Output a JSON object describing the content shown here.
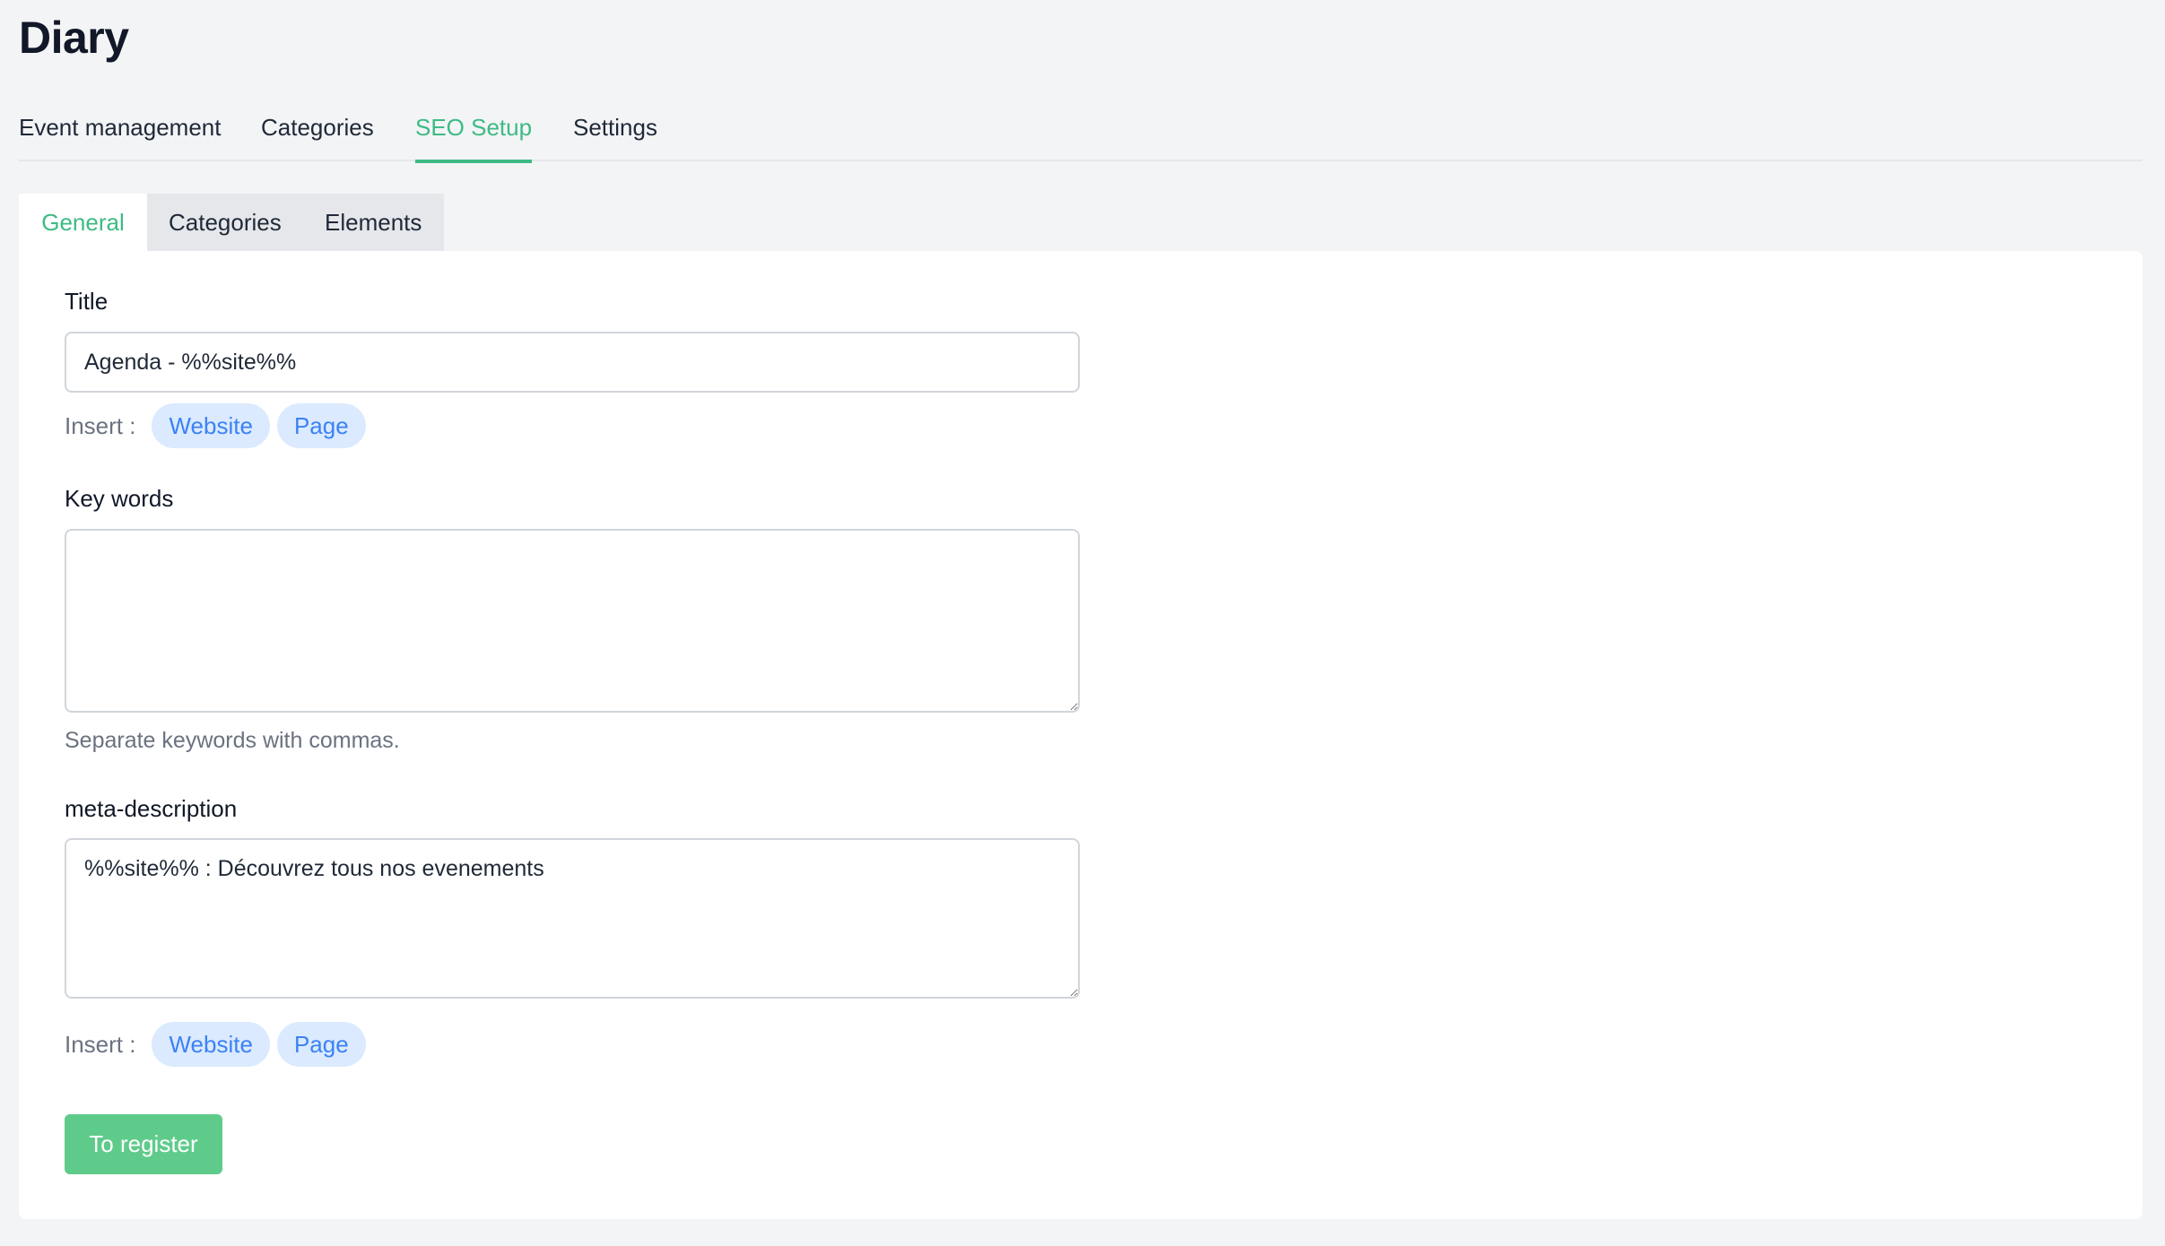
{
  "page": {
    "title": "Diary"
  },
  "main_tabs": [
    {
      "label": "Event management",
      "active": false
    },
    {
      "label": "Categories",
      "active": false
    },
    {
      "label": "SEO Setup",
      "active": true
    },
    {
      "label": "Settings",
      "active": false
    }
  ],
  "sub_tabs": [
    {
      "label": "General",
      "active": true
    },
    {
      "label": "Categories",
      "active": false
    },
    {
      "label": "Elements",
      "active": false
    }
  ],
  "form": {
    "title": {
      "label": "Title",
      "value": "Agenda - %%site%%"
    },
    "title_insert": {
      "label": "Insert :",
      "chips": [
        "Website",
        "Page"
      ]
    },
    "keywords": {
      "label": "Key words",
      "value": "",
      "help": "Separate keywords with commas."
    },
    "meta_description": {
      "label": "meta-description",
      "value": "%%site%% : Découvrez tous nos evenements"
    },
    "meta_insert": {
      "label": "Insert :",
      "chips": [
        "Website",
        "Page"
      ]
    },
    "submit_label": "To register"
  },
  "colors": {
    "accent": "#3dbb84",
    "button": "#5fcb8b",
    "chip_bg": "#dbeafe",
    "chip_text": "#3b82f6",
    "background": "#f3f4f6"
  }
}
